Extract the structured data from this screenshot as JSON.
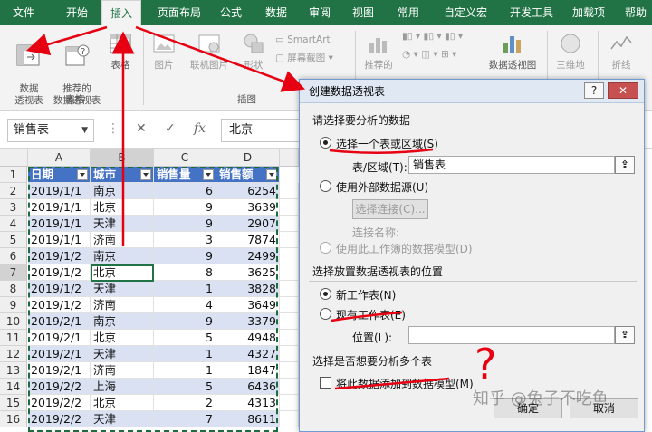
{
  "ribbon_tabs": [
    "文件",
    "开始",
    "插入",
    "页面布局",
    "公式",
    "数据",
    "审阅",
    "视图",
    "常用",
    "自定义宏",
    "开发工具",
    "加载项",
    "帮助"
  ],
  "active_tab": "插入",
  "ribbon": {
    "pivot_table": "数据\n透视表",
    "recommended_pivot": "推荐的\n数据透视表",
    "table": "表格",
    "group_tables": "表格",
    "pictures": "图片",
    "online_pictures": "联机图片",
    "shapes": "形状",
    "smartart": "SmartArt",
    "screenshot": "屏幕截图",
    "group_illustrations": "插图",
    "recommended_charts": "推荐的",
    "pivot_chart": "数据透视图",
    "map_3d": "三维地",
    "line": "折线"
  },
  "formula_bar": {
    "name_box": "销售表",
    "cancel_icon": "✕",
    "enter_icon": "✓",
    "fx": "fx",
    "value": "北京"
  },
  "sheet": {
    "columns": [
      "A",
      "B",
      "C",
      "D"
    ],
    "selected_column": "B",
    "selected_row": "7",
    "header": [
      "日期",
      "城市",
      "销售量",
      "销售额"
    ],
    "rows": [
      {
        "n": "2",
        "date": "2019/1/1",
        "city": "南京",
        "qty": "6",
        "amt": "6254"
      },
      {
        "n": "3",
        "date": "2019/1/1",
        "city": "北京",
        "qty": "9",
        "amt": "3639"
      },
      {
        "n": "4",
        "date": "2019/1/1",
        "city": "天津",
        "qty": "9",
        "amt": "2907"
      },
      {
        "n": "5",
        "date": "2019/1/1",
        "city": "济南",
        "qty": "3",
        "amt": "7874"
      },
      {
        "n": "6",
        "date": "2019/1/2",
        "city": "南京",
        "qty": "9",
        "amt": "2499"
      },
      {
        "n": "7",
        "date": "2019/1/2",
        "city": "北京",
        "qty": "8",
        "amt": "3625"
      },
      {
        "n": "8",
        "date": "2019/1/2",
        "city": "天津",
        "qty": "1",
        "amt": "3828"
      },
      {
        "n": "9",
        "date": "2019/1/2",
        "city": "济南",
        "qty": "4",
        "amt": "3649"
      },
      {
        "n": "10",
        "date": "2019/2/1",
        "city": "南京",
        "qty": "9",
        "amt": "3379"
      },
      {
        "n": "11",
        "date": "2019/2/1",
        "city": "北京",
        "qty": "5",
        "amt": "4948"
      },
      {
        "n": "12",
        "date": "2019/2/1",
        "city": "天津",
        "qty": "1",
        "amt": "4327"
      },
      {
        "n": "13",
        "date": "2019/2/1",
        "city": "济南",
        "qty": "1",
        "amt": "1847"
      },
      {
        "n": "14",
        "date": "2019/2/2",
        "city": "上海",
        "qty": "5",
        "amt": "6436"
      },
      {
        "n": "15",
        "date": "2019/2/2",
        "city": "北京",
        "qty": "2",
        "amt": "4313"
      },
      {
        "n": "16",
        "date": "2019/2/2",
        "city": "天津",
        "qty": "7",
        "amt": "8611"
      }
    ],
    "header_row_number": "1"
  },
  "dialog": {
    "title": "创建数据透视表",
    "help_button": "?",
    "close_button": "✕",
    "section_choose_data": "请选择要分析的数据",
    "opt_select_range": "选择一个表或区域(S)",
    "range_label": "表/区域(T):",
    "range_value": "销售表",
    "opt_external": "使用外部数据源(U)",
    "choose_connection": "选择连接(C)...",
    "connection_name": "连接名称:",
    "opt_data_model": "使用此工作簿的数据模型(D)",
    "section_location": "选择放置数据透视表的位置",
    "opt_new_sheet": "新工作表(N)",
    "opt_existing_sheet": "现有工作表(E)",
    "location_label": "位置(L):",
    "location_value": "",
    "section_multiple": "选择是否想要分析多个表",
    "add_to_model": "将此数据添加到数据模型(M)",
    "ok": "确定",
    "cancel": "取消",
    "picker_icon": "range-picker-icon"
  },
  "watermark": "知乎 @兔子不吃鱼",
  "annotation_question_mark": "?",
  "colors": {
    "excel_green": "#217346",
    "table_header_blue": "#4472c4",
    "band_blue": "#d9e1f2",
    "annotation_red": "#e60012"
  }
}
